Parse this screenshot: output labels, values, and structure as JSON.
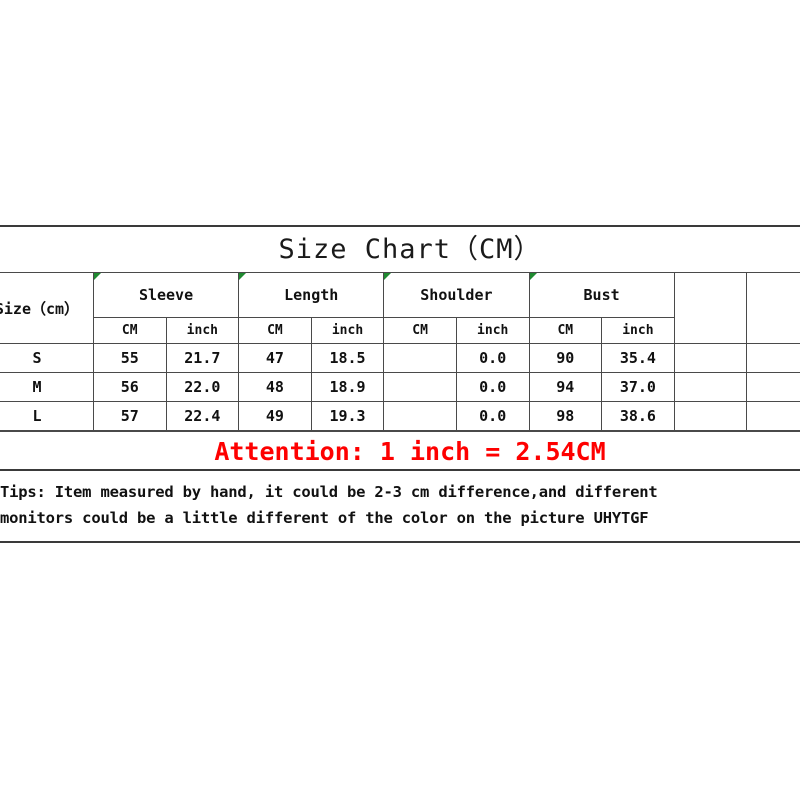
{
  "title": "Size Chart（CM）",
  "table": {
    "size_header": "Size（cm）",
    "groups": [
      {
        "label": "Sleeve"
      },
      {
        "label": "Length"
      },
      {
        "label": "Shoulder"
      },
      {
        "label": "Bust"
      }
    ],
    "units": {
      "cm": "CM",
      "inch": "inch"
    },
    "unit_color": "#FE0000",
    "rows": [
      {
        "size": "S",
        "sleeve_cm": "55",
        "sleeve_inch": "21.7",
        "length_cm": "47",
        "length_inch": "18.5",
        "shoulder_cm": "",
        "shoulder_inch": "0.0",
        "bust_cm": "90",
        "bust_inch": "35.4"
      },
      {
        "size": "M",
        "sleeve_cm": "56",
        "sleeve_inch": "22.0",
        "length_cm": "48",
        "length_inch": "18.9",
        "shoulder_cm": "",
        "shoulder_inch": "0.0",
        "bust_cm": "94",
        "bust_inch": "37.0"
      },
      {
        "size": "L",
        "sleeve_cm": "57",
        "sleeve_inch": "22.4",
        "length_cm": "49",
        "length_inch": "19.3",
        "shoulder_cm": "",
        "shoulder_inch": "0.0",
        "bust_cm": "98",
        "bust_inch": "38.6"
      }
    ],
    "trailing_blank_columns": 2
  },
  "attention": {
    "text": "Attention: 1 inch = 2.54CM",
    "color": "#FE0000"
  },
  "tips": {
    "line1": "Tips: Item measured by hand, it could be 2-3 cm difference,and different",
    "line2": "monitors could be a little different of the color on the picture UHYTGF"
  }
}
